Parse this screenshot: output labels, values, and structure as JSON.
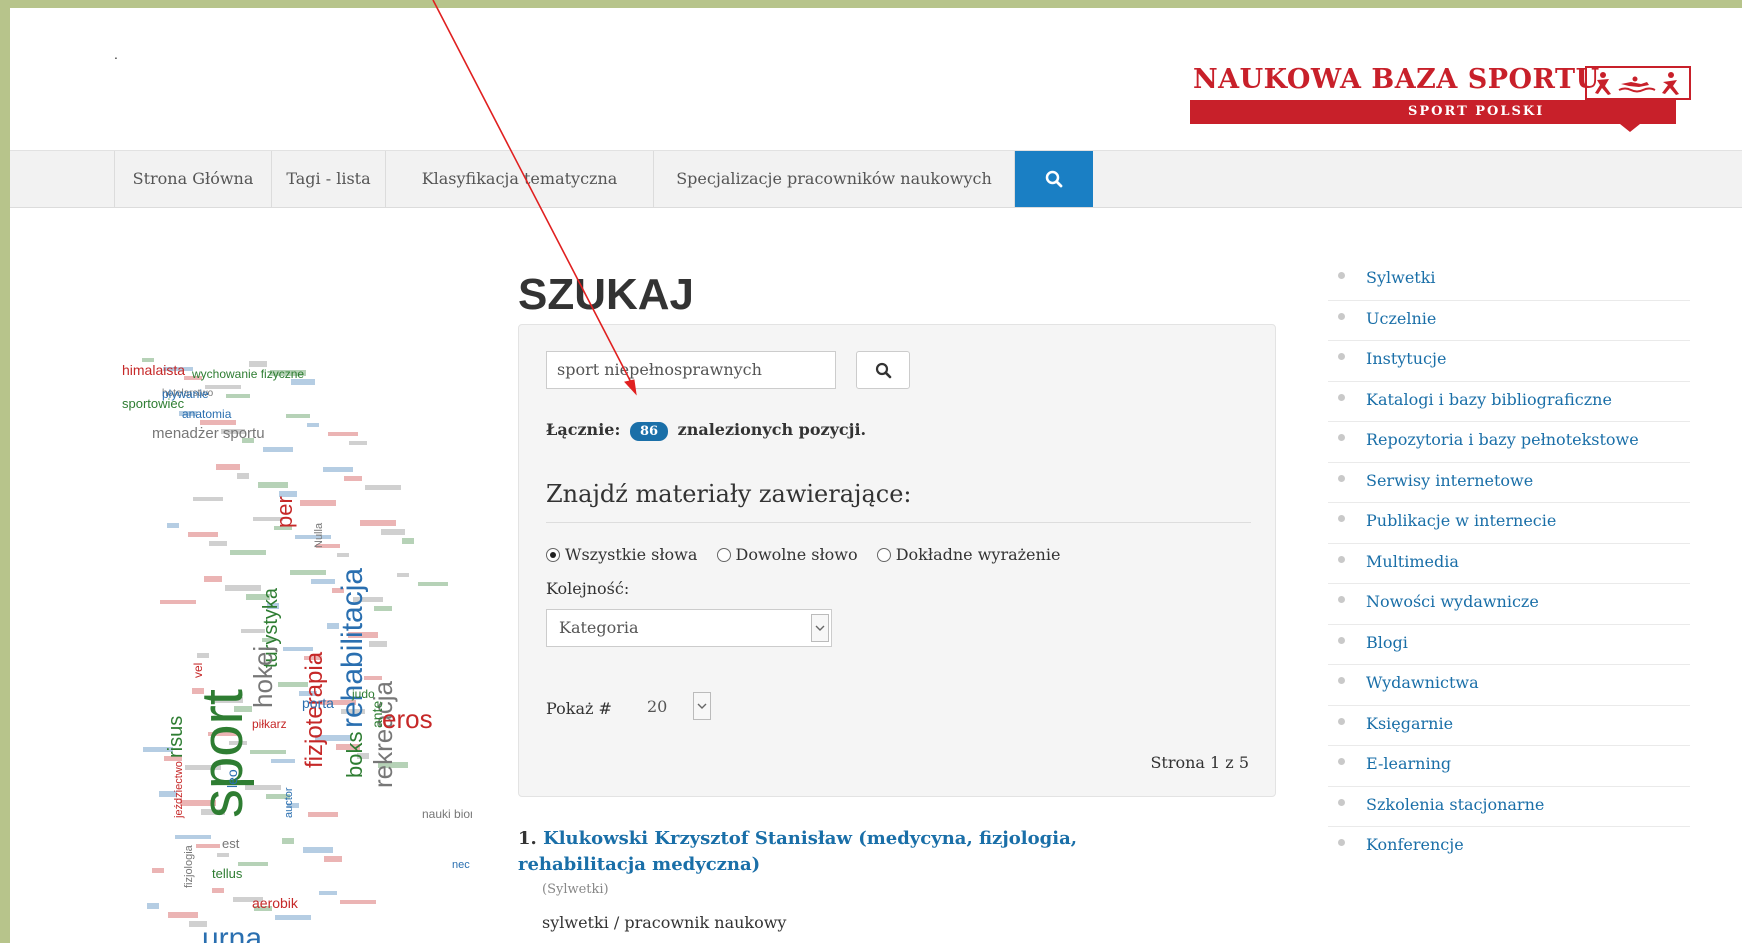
{
  "header": {
    "dot": ".",
    "logo": {
      "title": "NAUKOWA BAZA SPORTU",
      "subtitle": "SPORT POLSKI",
      "brand_color": "#c8202a"
    }
  },
  "nav": {
    "items": [
      {
        "label": "Strona Główna"
      },
      {
        "label": "Tagi - lista"
      },
      {
        "label": "Klasyfikacja tematyczna"
      },
      {
        "label": "Specjalizacje pracowników naukowych"
      }
    ],
    "search_icon": "search-icon",
    "accent": "#1a7fc4"
  },
  "main": {
    "title": "SZUKAJ",
    "search": {
      "value": "sport niepełnosprawnych"
    },
    "total_prefix": "Łącznie:",
    "total_count": "86",
    "total_suffix": "znalezionych pozycji.",
    "find_heading": "Znajdź materiały zawierające:",
    "radios": [
      {
        "label": "Wszystkie słowa",
        "checked": true
      },
      {
        "label": "Dowolne słowo",
        "checked": false
      },
      {
        "label": "Dokładne wyrażenie",
        "checked": false
      }
    ],
    "order_label": "Kolejność:",
    "order_value": "Kategoria",
    "show_label": "Pokaż #",
    "show_value": "20",
    "page_info": "Strona 1 z 5"
  },
  "results": [
    {
      "number": "1.",
      "title": "Klukowski Krzysztof Stanisław (medycyna, fizjologia, rehabilitacja medyczna)",
      "category": "(Sylwetki)",
      "description": "sylwetki / pracownik naukowy"
    }
  ],
  "sidebar": {
    "items": [
      {
        "label": "Sylwetki"
      },
      {
        "label": "Uczelnie"
      },
      {
        "label": "Instytucje"
      },
      {
        "label": "Katalogi i bazy bibliograficzne"
      },
      {
        "label": "Repozytoria i bazy pełnotekstowe"
      },
      {
        "label": "Serwisy internetowe"
      },
      {
        "label": "Publikacje w internecie"
      },
      {
        "label": "Multimedia"
      },
      {
        "label": "Nowości wydawnicze"
      },
      {
        "label": "Blogi"
      },
      {
        "label": "Wydawnictwa"
      },
      {
        "label": "Księgarnie"
      },
      {
        "label": "E-learning"
      },
      {
        "label": "Szkolenia stacjonarne"
      },
      {
        "label": "Konferencje"
      }
    ]
  },
  "word_cloud": {
    "words": [
      "sport",
      "rehabilitacja",
      "fizjoterapia",
      "rekreacja",
      "turystyka",
      "urna",
      "aerobik",
      "hokej",
      "judo",
      "porta",
      "himalaista",
      "hotelarstwo",
      "sportowiec",
      "pływanie",
      "piłkarz",
      "nauki biomedyczne",
      "boks",
      "auctor",
      "eros",
      "menadżer sportu",
      "wychowanie fizyczne",
      "anatomia",
      "jeździectwo",
      "fizjologia",
      "tellus",
      "nec",
      "vel",
      "est",
      "risus",
      "leo",
      "per",
      "Nulla",
      "ante"
    ],
    "colors": [
      "#2e7d32",
      "#2a6fb0",
      "#c62828",
      "#777777"
    ]
  },
  "annotation": {
    "arrow_color": "#e02020"
  }
}
